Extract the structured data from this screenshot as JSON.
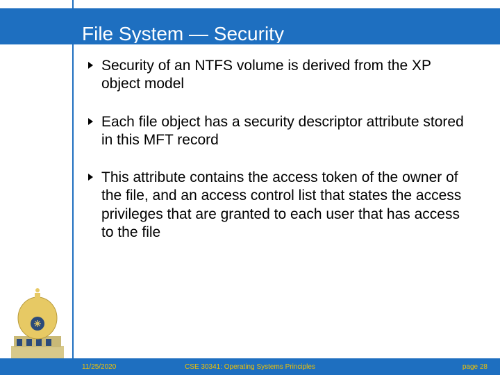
{
  "title": "File System — Security",
  "bullets": [
    "Security of an NTFS volume is derived from the XP object model",
    "Each file object has a security descriptor attribute stored in this MFT record",
    "This attribute contains the access token of the owner of the file, and an access control list that states the access privileges that are granted to each user that has access to the file"
  ],
  "footer": {
    "date": "11/25/2020",
    "course": "CSE 30341: Operating Systems Principles",
    "page": "page 28"
  },
  "colors": {
    "accent": "#1e6fc0",
    "footer_text": "#f2c200"
  }
}
